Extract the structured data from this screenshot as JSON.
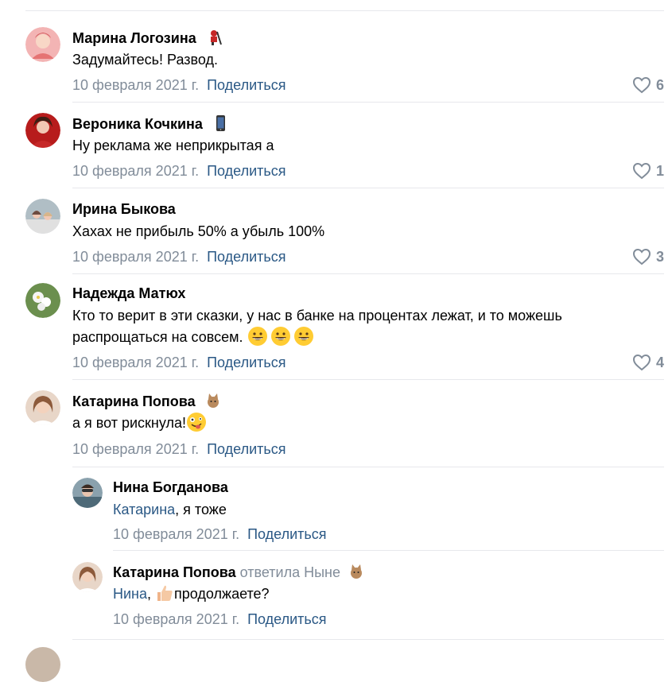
{
  "comments": [
    {
      "author": "Марина Логозина",
      "text": "Задумайтесь! Развод.",
      "date": "10 февраля 2021 г.",
      "share": "Поделиться",
      "likes": "6",
      "avatar_color": "#e57373"
    },
    {
      "author": "Вероника Кочкина",
      "text": "Ну реклама же неприкрытая а",
      "date": "10 февраля 2021 г.",
      "share": "Поделиться",
      "likes": "1",
      "avatar_color": "#c62828"
    },
    {
      "author": "Ирина Быкова",
      "text": "Хахах не прибыль 50% а убыль 100%",
      "date": "10 февраля 2021 г.",
      "share": "Поделиться",
      "likes": "3",
      "avatar_color": "#90a4ae"
    },
    {
      "author": "Надежда Матюх",
      "text_line1": "Кто то верит в эти сказки, у нас в банке на процентах лежат, и то можешь",
      "text_line2": "распрощаться на совсем.",
      "date": "10 февраля 2021 г.",
      "share": "Поделиться",
      "likes": "4",
      "avatar_color": "#7aa860"
    },
    {
      "author": "Катарина Попова",
      "text": "а я вот рискнула!",
      "date": "10 февраля 2021 г.",
      "share": "Поделиться",
      "avatar_color": "#c9a48a"
    }
  ],
  "replies": [
    {
      "author": "Нина Богданова",
      "mention": "Катарина",
      "text": ", я тоже",
      "date": "10 февраля 2021 г.",
      "share": "Поделиться",
      "avatar_color": "#5d7b8a"
    },
    {
      "author": "Катарина Попова",
      "answered": "ответила Ныне",
      "mention": "Нина",
      "text_pre": ", ",
      "text": "продолжаете?",
      "date": "10 февраля 2021 г.",
      "share": "Поделиться",
      "avatar_color": "#c9a48a"
    }
  ],
  "colors": {
    "link": "#2a5885",
    "muted": "#818c99",
    "divider": "#e7e8ec"
  }
}
